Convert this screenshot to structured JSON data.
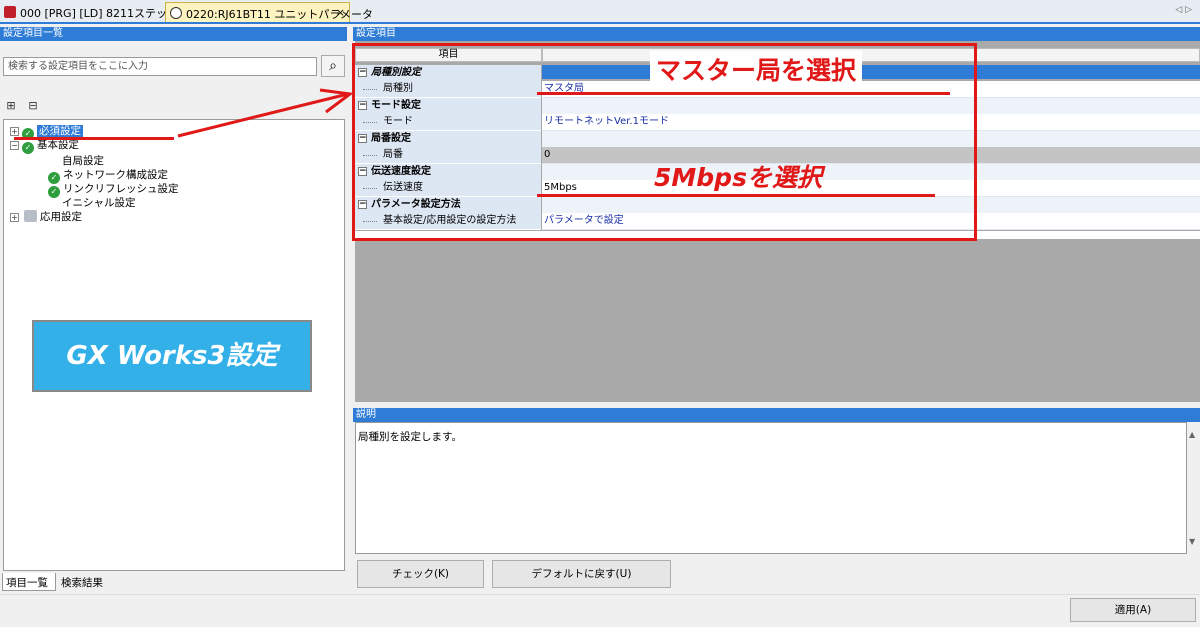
{
  "tabs": [
    {
      "label": "000 [PRG] [LD] 8211ステップ"
    },
    {
      "label": "0220:RJ61BT11 ユニットパラメータ",
      "close": "×"
    }
  ],
  "tab_scroll": "◁ ▷",
  "left_panel": {
    "title": "設定項目一覧",
    "search_placeholder": "検索する設定項目をここに入力",
    "tree": {
      "required": "必須設定",
      "basic": "基本設定",
      "own_station": "自局設定",
      "network": "ネットワーク構成設定",
      "refresh": "リンクリフレッシュ設定",
      "initial": "イニシャル設定",
      "application": "応用設定"
    },
    "tabs": {
      "list": "項目一覧",
      "results": "検索結果"
    }
  },
  "right_panel": {
    "title": "設定項目",
    "column_header": "項目",
    "categories": {
      "station_type": {
        "name": "局種別設定",
        "item": "局種別",
        "value": "マスタ局"
      },
      "mode": {
        "name": "モード設定",
        "item": "モード",
        "value": "リモートネットVer.1モード"
      },
      "station_no": {
        "name": "局番設定",
        "item": "局番",
        "value": "0"
      },
      "speed": {
        "name": "伝送速度設定",
        "item": "伝送速度",
        "value": "5Mbps"
      },
      "param_method": {
        "name": "パラメータ設定方法",
        "item": "基本設定/応用設定の設定方法",
        "value": "パラメータで設定"
      }
    }
  },
  "annotations": {
    "select_master": "マスター局を選択",
    "select_speed": "5Mbpsを選択",
    "gx_label": "GX Works3設定",
    "accent_color": "#e01818"
  },
  "description": {
    "title": "説明",
    "text": "局種別を設定します。"
  },
  "buttons": {
    "check": "チェック(K)",
    "default": "デフォルトに戻す(U)",
    "apply": "適用(A)"
  }
}
